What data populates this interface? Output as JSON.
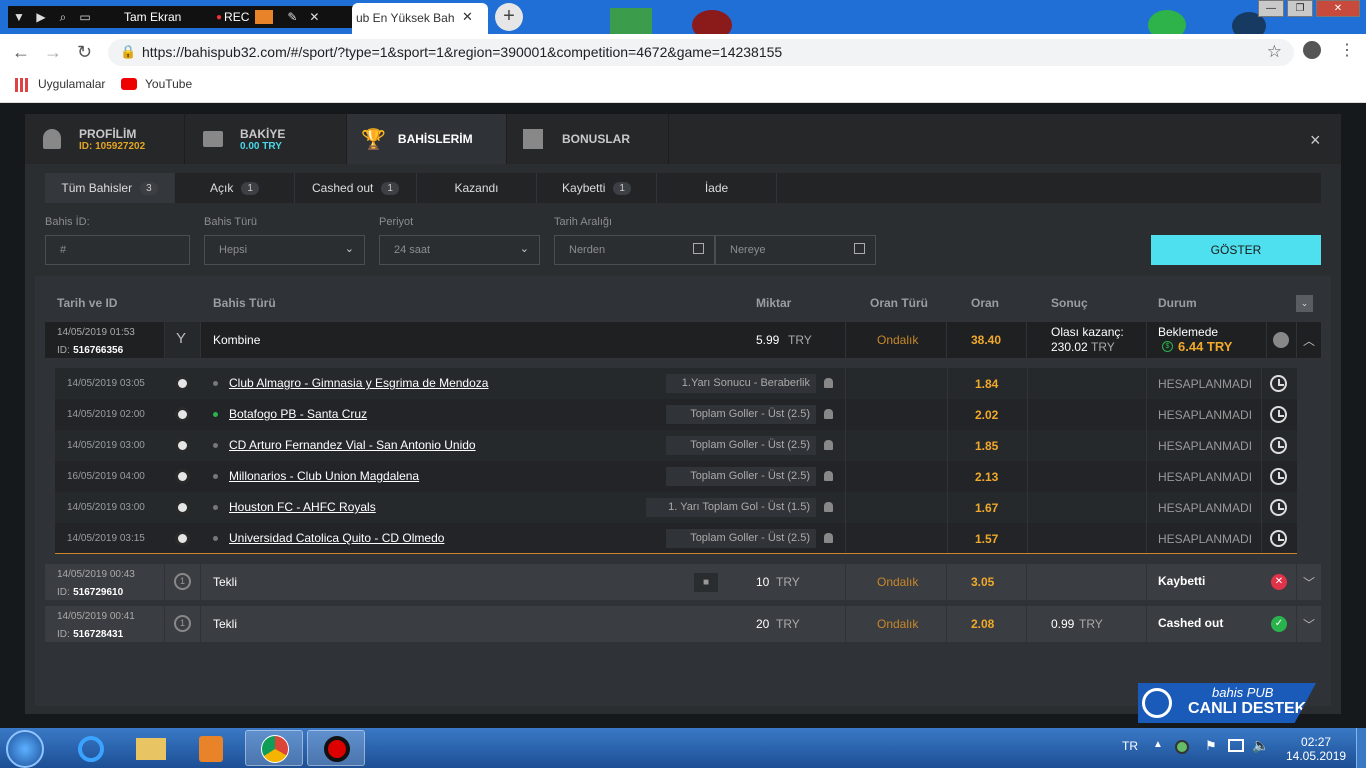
{
  "browser": {
    "recorder": {
      "fullscreen_label": "Tam Ekran",
      "rec_label": "REC"
    },
    "tab_title": "ub En Yüksek Bah",
    "url": "https://bahispub32.com/#/sport/?type=1&sport=1&region=390001&competition=4672&game=14238155",
    "bookmarks": [
      {
        "label": "Uygulamalar"
      },
      {
        "label": "YouTube"
      }
    ]
  },
  "modal": {
    "tabs": [
      {
        "label": "PROFİLİM",
        "sub": "ID: 105927202"
      },
      {
        "label": "BAKİYE",
        "sub": "0.00 TRY"
      },
      {
        "label": "BAHİSLERİM",
        "sub": ""
      },
      {
        "label": "BONUSLAR",
        "sub": ""
      }
    ],
    "close_icon": "×"
  },
  "filter_tabs": [
    {
      "label": "Tüm Bahisler",
      "count": "3"
    },
    {
      "label": "Açık",
      "count": "1"
    },
    {
      "label": "Cashed out",
      "count": "1"
    },
    {
      "label": "Kazandı",
      "count": ""
    },
    {
      "label": "Kaybetti",
      "count": "1"
    },
    {
      "label": "İade",
      "count": ""
    }
  ],
  "filters": {
    "bet_id_label": "Bahis İD:",
    "bet_id_placeholder": "#",
    "bet_type_label": "Bahis Türü",
    "bet_type_value": "Hepsi",
    "period_label": "Periyot",
    "period_value": "24 saat",
    "date_range_label": "Tarih Aralığı",
    "from_placeholder": "Nerden",
    "to_placeholder": "Nereye",
    "show_button": "GÖSTER"
  },
  "table_headers": {
    "date_id": "Tarih ve ID",
    "bet_type": "Bahis Türü",
    "amount": "Miktar",
    "odds_type": "Oran Türü",
    "odds": "Oran",
    "result": "Sonuç",
    "status": "Durum"
  },
  "bets": [
    {
      "date": "14/05/2019 01:53",
      "id_label": "ID:",
      "id": "516766356",
      "type": "Kombine",
      "amount": "5.99",
      "currency": "TRY",
      "odds_type": "Ondalık",
      "odds": "38.40",
      "result_label": "Olası kazanç:",
      "result_value": "230.02",
      "result_currency": "TRY",
      "status": "Beklemede",
      "cashout_value": "6.44 TRY",
      "selections": [
        {
          "date": "14/05/2019 03:05",
          "match": "Club Almagro - Gimnasia y Esgrima de Mendoza",
          "market": "1.Yarı Sonucu - Beraberlik",
          "odds": "1.84",
          "status": "HESAPLANMADI",
          "live": false
        },
        {
          "date": "14/05/2019 02:00",
          "match": "Botafogo PB - Santa Cruz",
          "market": "Toplam Goller - Üst (2.5)",
          "odds": "2.02",
          "status": "HESAPLANMADI",
          "live": true
        },
        {
          "date": "14/05/2019 03:00",
          "match": "CD Arturo Fernandez Vial - San Antonio Unido",
          "market": "Toplam Goller - Üst (2.5)",
          "odds": "1.85",
          "status": "HESAPLANMADI",
          "live": false
        },
        {
          "date": "16/05/2019 04:00",
          "match": "Millonarios - Club Union Magdalena",
          "market": "Toplam Goller - Üst (2.5)",
          "odds": "2.13",
          "status": "HESAPLANMADI",
          "live": false
        },
        {
          "date": "14/05/2019 03:00",
          "match": "Houston FC - AHFC Royals",
          "market": "1. Yarı Toplam Gol - Üst (1.5)",
          "odds": "1.67",
          "status": "HESAPLANMADI",
          "live": false
        },
        {
          "date": "14/05/2019 03:15",
          "match": "Universidad Catolica Quito - CD Olmedo",
          "market": "Toplam Goller - Üst (2.5)",
          "odds": "1.57",
          "status": "HESAPLANMADI",
          "live": false
        }
      ]
    },
    {
      "date": "14/05/2019 00:43",
      "id_label": "ID:",
      "id": "516729610",
      "type": "Tekli",
      "amount": "10",
      "currency": "TRY",
      "odds_type": "Ondalık",
      "odds": "3.05",
      "result_value": "",
      "status": "Kaybetti"
    },
    {
      "date": "14/05/2019 00:41",
      "id_label": "ID:",
      "id": "516728431",
      "type": "Tekli",
      "amount": "20",
      "currency": "TRY",
      "odds_type": "Ondalık",
      "odds": "2.08",
      "result_value": "0.99",
      "result_currency": "TRY",
      "status": "Cashed out"
    }
  ],
  "support": {
    "brand": "bahis PUB",
    "label": "CANLI DESTEK"
  },
  "taskbar": {
    "lang": "TR",
    "time": "02:27",
    "date": "14.05.2019"
  },
  "colors": {
    "accent": "#4ee0ef",
    "odds": "#f0a92a",
    "lost": "#e0334a",
    "cashed": "#2ab34d"
  }
}
